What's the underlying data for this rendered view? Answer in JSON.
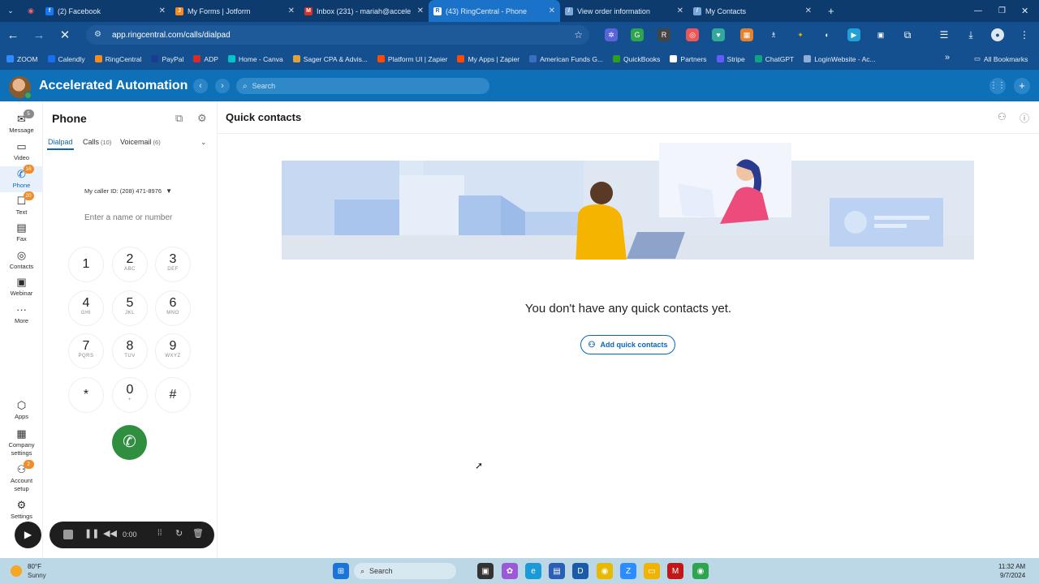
{
  "browser": {
    "tabs": [
      {
        "title": "(2) Facebook",
        "color": "#1877f2",
        "glyph": "f"
      },
      {
        "title": "My Forms | Jotform",
        "color": "#f58b1f",
        "glyph": "J"
      },
      {
        "title": "Inbox (231) - mariah@accele",
        "color": "#d93025",
        "glyph": "M"
      },
      {
        "title": "(43) RingCentral - Phone",
        "color": "#ffffff",
        "glyph": "R",
        "active": true
      },
      {
        "title": "View order information",
        "color": "#7aa7d8",
        "glyph": "/"
      },
      {
        "title": "My Contacts",
        "color": "#7aa7d8",
        "glyph": "/"
      }
    ],
    "url": "app.ringcentral.com/calls/dialpad",
    "bookmarks": [
      "ZOOM",
      "Calendly",
      "RingCentral",
      "PayPal",
      "ADP",
      "Home - Canva",
      "Sager CPA & Advis...",
      "Platform UI | Zapier",
      "My Apps | Zapier",
      "American Funds G...",
      "QuickBooks",
      "Partners",
      "Stripe",
      "ChatGPT",
      "LoginWebsite - Ac..."
    ],
    "all_bookmarks": "All Bookmarks"
  },
  "app": {
    "name": "Accelerated Automation",
    "search_placeholder": "Search"
  },
  "rail": {
    "items": [
      {
        "label": "Message",
        "badge": "5",
        "icon": "message-icon"
      },
      {
        "label": "Video",
        "icon": "video-icon"
      },
      {
        "label": "Phone",
        "badge": "16",
        "icon": "phone-icon",
        "active": true
      },
      {
        "label": "Text",
        "badge": "20",
        "icon": "text-icon"
      },
      {
        "label": "Fax",
        "icon": "fax-icon"
      },
      {
        "label": "Contacts",
        "icon": "contacts-icon"
      },
      {
        "label": "Webinar",
        "icon": "webinar-icon"
      },
      {
        "label": "More",
        "icon": "more-icon"
      }
    ],
    "bottom": [
      {
        "label": "Apps",
        "icon": "apps-icon"
      },
      {
        "label": "Company settings",
        "icon": "company-icon"
      },
      {
        "label": "Account setup",
        "badge": "2",
        "icon": "account-icon"
      },
      {
        "label": "Settings",
        "icon": "settings-icon"
      }
    ]
  },
  "phone": {
    "title": "Phone",
    "tabs": [
      {
        "label": "Dialpad"
      },
      {
        "label": "Calls",
        "count": "(10)"
      },
      {
        "label": "Voicemail",
        "count": "(6)"
      }
    ],
    "caller_id": "My caller ID: (208) 471-8976",
    "number_placeholder": "Enter a name or number",
    "keys": [
      {
        "d": "1",
        "l": ""
      },
      {
        "d": "2",
        "l": "ABC"
      },
      {
        "d": "3",
        "l": "DEF"
      },
      {
        "d": "4",
        "l": "GHI"
      },
      {
        "d": "5",
        "l": "JKL"
      },
      {
        "d": "6",
        "l": "MNO"
      },
      {
        "d": "7",
        "l": "PQRS"
      },
      {
        "d": "8",
        "l": "TUV"
      },
      {
        "d": "9",
        "l": "WXYZ"
      },
      {
        "d": "*",
        "l": ""
      },
      {
        "d": "0",
        "l": "+"
      },
      {
        "d": "#",
        "l": ""
      }
    ]
  },
  "main": {
    "title": "Quick contacts",
    "empty_message": "You don't have any quick contacts yet.",
    "add_button": "Add quick contacts"
  },
  "recorder": {
    "time": "0:00"
  },
  "taskbar": {
    "weather_temp": "80°F",
    "weather_desc": "Sunny",
    "search": "Search",
    "time": "11:32 AM",
    "date": "9/7/2024"
  }
}
